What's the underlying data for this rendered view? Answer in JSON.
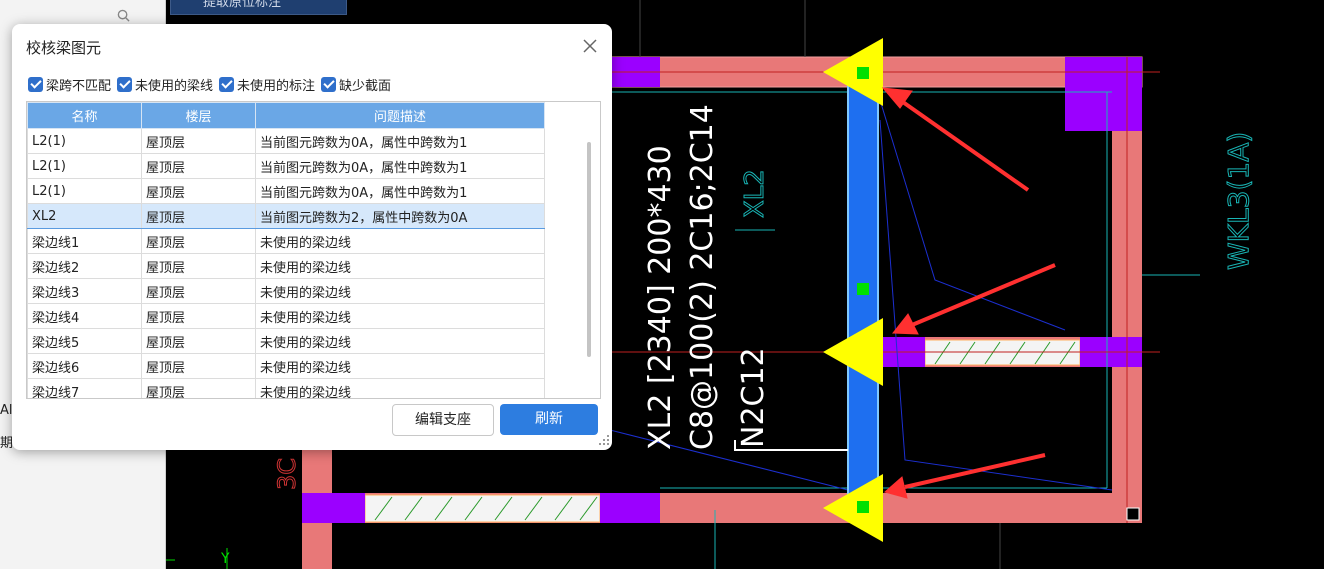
{
  "dialog": {
    "title": "校核梁图元",
    "checkboxes": [
      {
        "label": "梁跨不匹配",
        "checked": true
      },
      {
        "label": "未使用的梁线",
        "checked": true
      },
      {
        "label": "未使用的标注",
        "checked": true
      },
      {
        "label": "缺少截面",
        "checked": true
      }
    ],
    "columns": [
      "名称",
      "楼层",
      "问题描述"
    ],
    "rows": [
      [
        "L2(1)",
        "屋顶层",
        "当前图元跨数为0A，属性中跨数为1"
      ],
      [
        "L2(1)",
        "屋顶层",
        "当前图元跨数为0A，属性中跨数为1"
      ],
      [
        "L2(1)",
        "屋顶层",
        "当前图元跨数为0A，属性中跨数为1"
      ],
      [
        "XL2",
        "屋顶层",
        "当前图元跨数为2，属性中跨数为0A"
      ],
      [
        "梁边线1",
        "屋顶层",
        "未使用的梁边线"
      ],
      [
        "梁边线2",
        "屋顶层",
        "未使用的梁边线"
      ],
      [
        "梁边线3",
        "屋顶层",
        "未使用的梁边线"
      ],
      [
        "梁边线4",
        "屋顶层",
        "未使用的梁边线"
      ],
      [
        "梁边线5",
        "屋顶层",
        "未使用的梁边线"
      ],
      [
        "梁边线6",
        "屋顶层",
        "未使用的梁边线"
      ],
      [
        "梁边线7",
        "屋顶层",
        "未使用的梁边线"
      ]
    ],
    "selected_row": 3,
    "buttons": {
      "edit": "编辑支座",
      "refresh": "刷新"
    }
  },
  "toolbar": {
    "top_button": "提取原位标注"
  },
  "left_panel": {
    "partial_1": "Al",
    "partial_2": "期"
  },
  "cad": {
    "label_xl2_1": "XL2 [2340] 200*430",
    "label_xl2_2": "C8@100(2) 2C16;2C14",
    "label_xl2_3": "N2C12",
    "label_xl2_small": "XL2",
    "label_wkl3": "WKL3(1A)",
    "label_3c": "3C",
    "axis_y": "Y"
  },
  "colors": {
    "beam_pink": "#e87878",
    "support_purple": "#9b00ff",
    "selected_blue": "#1e6ff0",
    "marker_yellow": "#ffff00",
    "arrow_red": "#ff3030",
    "dialog_accent": "#2d7de0",
    "header_blue": "#6aa7e6"
  }
}
